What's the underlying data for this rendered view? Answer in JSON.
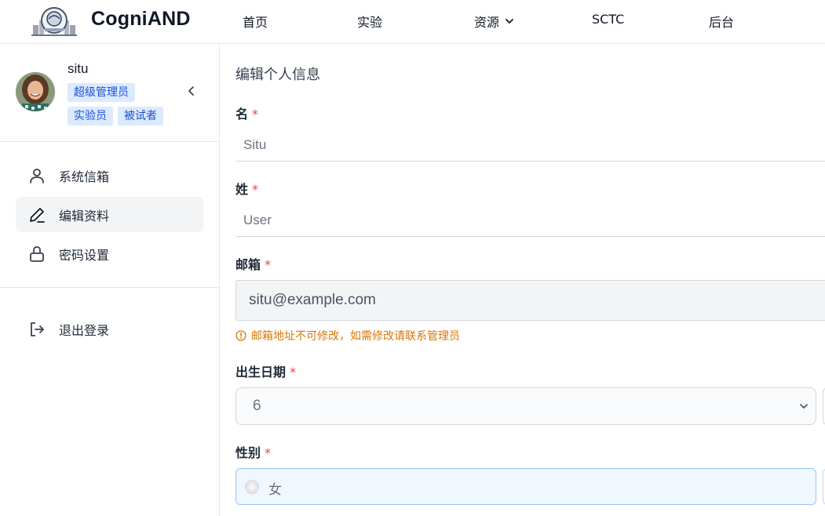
{
  "header": {
    "brand": "CogniAND",
    "nav": [
      {
        "label": "首页"
      },
      {
        "label": "实验"
      },
      {
        "label": "资源"
      },
      {
        "label": "SCTC"
      },
      {
        "label": "后台"
      }
    ]
  },
  "sidebar": {
    "user": {
      "name": "situ",
      "roles": [
        "超级管理员",
        "实验员",
        "被试者"
      ]
    },
    "menu": [
      {
        "label": "系统信箱",
        "icon": "user-icon"
      },
      {
        "label": "编辑资料",
        "icon": "pencil-icon",
        "active": true
      },
      {
        "label": "密码设置",
        "icon": "lock-icon"
      }
    ],
    "logout": {
      "label": "退出登录",
      "icon": "logout-icon"
    }
  },
  "form": {
    "title": "编辑个人信息",
    "required_mark": "*",
    "first_name": {
      "label": "名",
      "value": "Situ"
    },
    "last_name": {
      "label": "姓",
      "value": "User"
    },
    "email": {
      "label": "邮箱",
      "value": "situ@example.com",
      "hint": "邮箱地址不可修改，如需修改请联系管理员"
    },
    "birth": {
      "label": "出生日期",
      "value": "6"
    },
    "gender": {
      "label": "性别",
      "option": "女"
    }
  },
  "colors": {
    "badge_bg": "#dbeafe",
    "badge_text": "#1d4ed8",
    "required": "#ef4444",
    "hint": "#d97706",
    "active_menu_bg": "#f3f4f6"
  }
}
